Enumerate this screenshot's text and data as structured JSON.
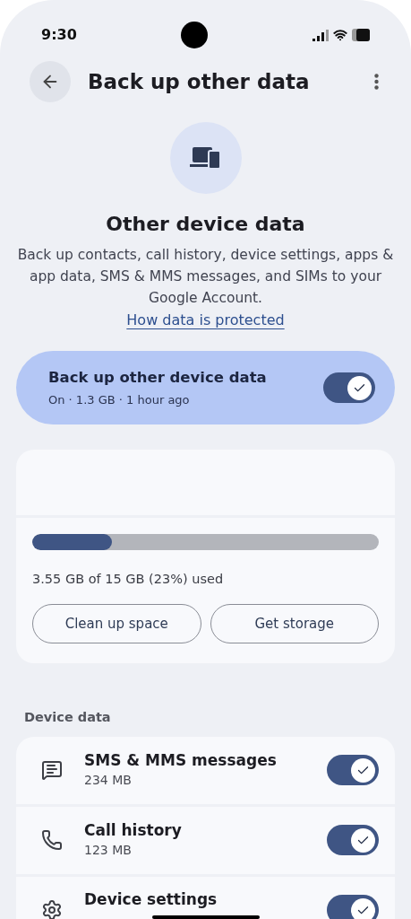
{
  "status_bar": {
    "time": "9:30"
  },
  "header": {
    "title": "Back up other data"
  },
  "intro": {
    "title": "Other device data",
    "description": "Back up contacts, call history, device settings, apps & app data, SMS & MMS messages, and SIMs to your Google Account.",
    "link": "How data is protected"
  },
  "main_toggle": {
    "title": "Back up other device data",
    "subtitle": "On · 1.3 GB · 1 hour ago",
    "on": true
  },
  "storage": {
    "level": 0.23,
    "usage": "3.55 GB of 15 GB (23%) used",
    "buttons": [
      "Clean up space",
      "Get storage"
    ]
  },
  "device_data": {
    "heading": "Device data",
    "items": [
      {
        "kind": "message",
        "title": "SMS & MMS messages",
        "size": "234 MB",
        "on": true
      },
      {
        "kind": "phone",
        "title": "Call history",
        "size": "123 MB",
        "on": true
      },
      {
        "kind": "gear",
        "title": "Device settings",
        "on": true
      }
    ]
  }
}
